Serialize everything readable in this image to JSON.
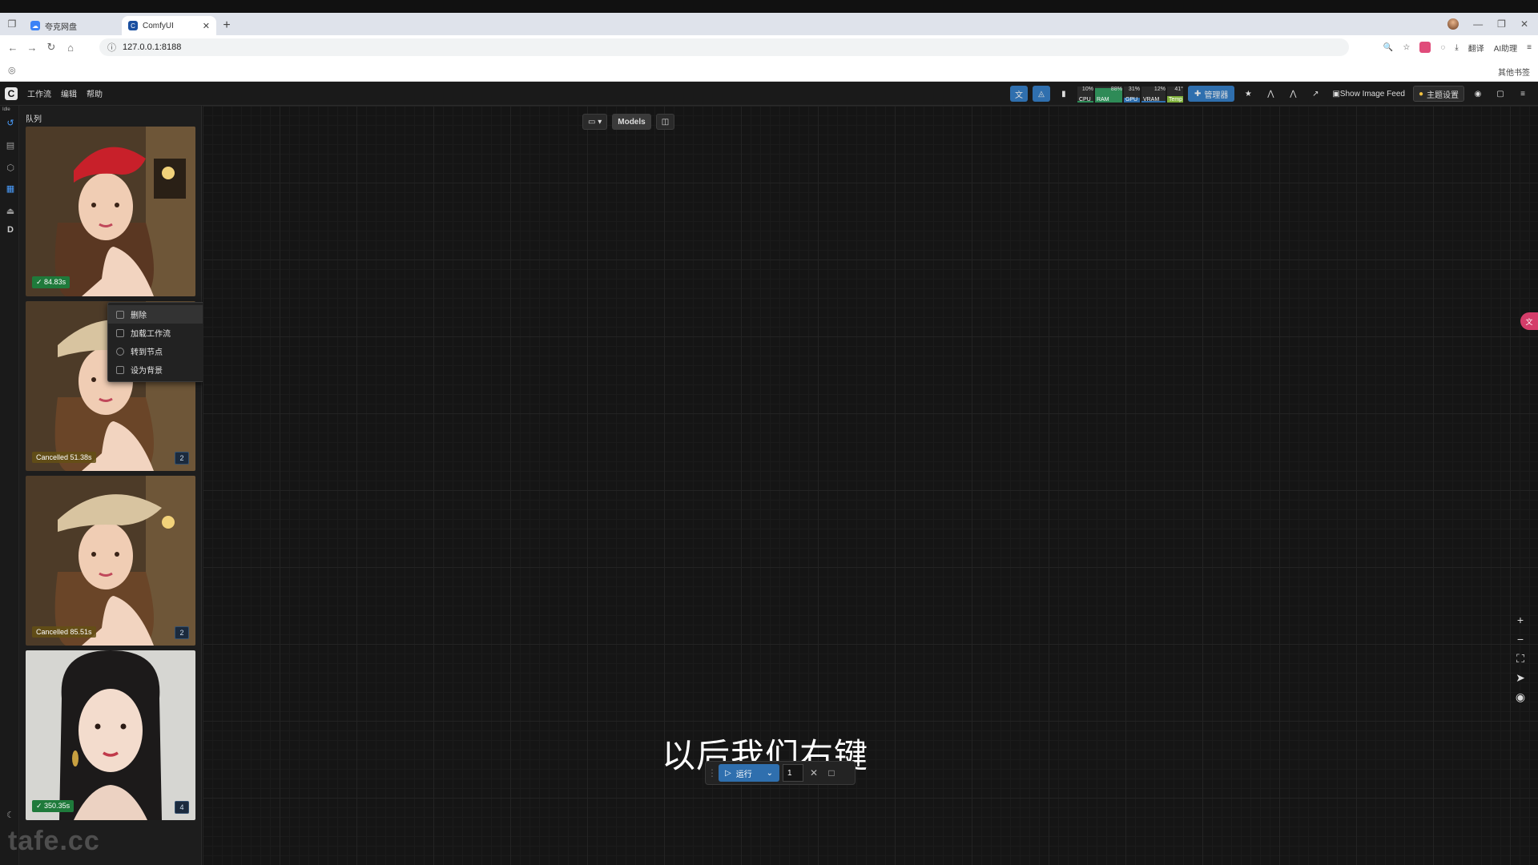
{
  "browser": {
    "tabs": [
      {
        "label": "夸克网盘",
        "active": false
      },
      {
        "label": "ComfyUI",
        "active": true
      }
    ],
    "url": "127.0.0.1:8188",
    "ext_labels": {
      "translate": "翻译",
      "ai": "AI助理"
    },
    "bookmarks_right": "其他书签"
  },
  "app": {
    "menu": [
      "工作流",
      "编辑",
      "帮助"
    ],
    "meters": [
      {
        "label": "CPU",
        "pct": "10%",
        "level": 10,
        "color": "#2e8b57"
      },
      {
        "label": "RAM",
        "pct": "88%",
        "level": 88,
        "color": "#2e8b57"
      },
      {
        "label": "GPU",
        "pct": "31%",
        "level": 31,
        "color": "#2f6fae"
      },
      {
        "label": "VRAM",
        "pct": "12%",
        "level": 12,
        "color": "#2f6fae"
      },
      {
        "label": "Temp",
        "pct": "41°",
        "level": 41,
        "color": "#7fb03a"
      }
    ],
    "manager_label": "管理器",
    "image_feed_label": "Show Image Feed",
    "theme_label": "主题设置",
    "status_label": "Idle"
  },
  "queue": {
    "title": "队列",
    "items": [
      {
        "status": "84.83s",
        "kind": "ok",
        "count": "",
        "hat": "red",
        "bg": "room"
      },
      {
        "status": "Cancelled 51.38s",
        "kind": "cancel",
        "count": "2",
        "hat": "straw",
        "bg": "room"
      },
      {
        "status": "Cancelled 85.51s",
        "kind": "cancel",
        "count": "2",
        "hat": "straw",
        "bg": "room"
      },
      {
        "status": "350.35s",
        "kind": "ok",
        "count": "4",
        "hat": "none",
        "bg": "white"
      }
    ]
  },
  "context_menu": {
    "items": [
      "删除",
      "加载工作流",
      "转到节点",
      "设为背景"
    ]
  },
  "canvas": {
    "models_label": "Models",
    "subtitle": "以后我们右键"
  },
  "runbar": {
    "run_label": "运行",
    "count": "1"
  },
  "watermark": "tafe.cc"
}
